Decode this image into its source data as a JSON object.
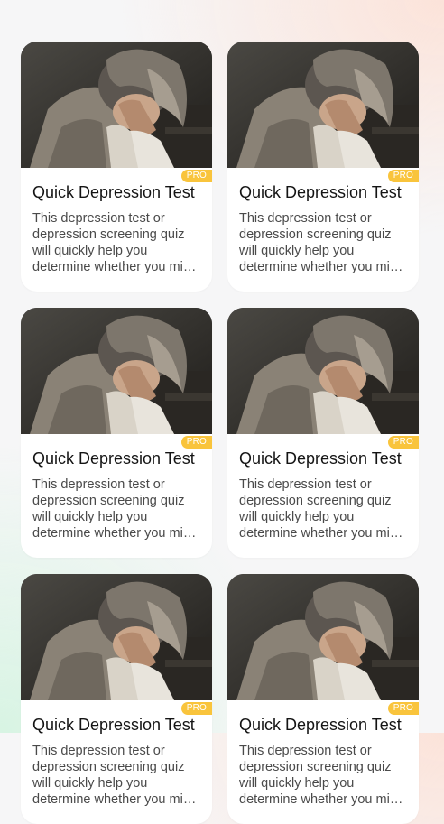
{
  "cards": [
    {
      "title": "Quick Depression Test",
      "description": "This depression test or depression screening quiz will quickly help you determine whether you might need to seek help",
      "badge": "PRO",
      "image": "person-head-in-hands-photo"
    },
    {
      "title": "Quick Depression Test",
      "description": "This depression test or depression screening quiz will quickly help you determine whether you might need to seek help",
      "badge": "PRO",
      "image": "person-head-in-hands-photo"
    },
    {
      "title": "Quick Depression Test",
      "description": "This depression test or depression screening quiz will quickly help you determine whether you might need to seek help",
      "badge": "PRO",
      "image": "person-head-in-hands-photo"
    },
    {
      "title": "Quick Depression Test",
      "description": "This depression test or depression screening quiz will quickly help you determine whether you might need to seek help",
      "badge": "PRO",
      "image": "person-head-in-hands-photo"
    },
    {
      "title": "Quick Depression Test",
      "description": "This depression test or depression screening quiz will quickly help you determine whether you might need to seek help",
      "badge": "PRO",
      "image": "person-head-in-hands-photo"
    },
    {
      "title": "Quick Depression Test",
      "description": "This depression test or depression screening quiz will quickly help you determine whether you might need to seek help",
      "badge": "PRO",
      "image": "person-head-in-hands-photo"
    }
  ],
  "colors": {
    "badge": "#f9c43c",
    "card": "#ffffff",
    "title": "#141414",
    "description": "#4a4a4a"
  }
}
